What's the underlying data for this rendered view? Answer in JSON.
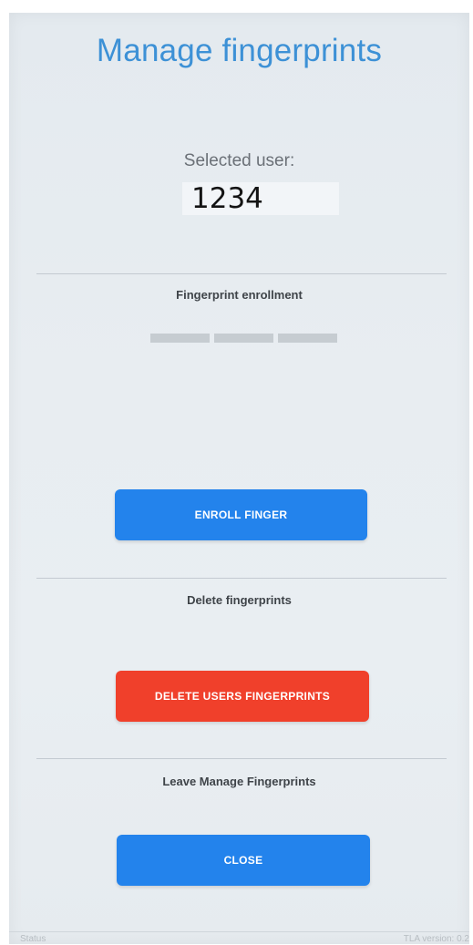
{
  "header": {
    "title": "Manage fingerprints"
  },
  "user": {
    "label": "Selected user:",
    "value": "1234"
  },
  "enrollment": {
    "heading": "Fingerprint enrollment",
    "progress_segments_filled": 0,
    "progress_segments_total": 3,
    "button_label": "ENROLL FINGER"
  },
  "delete": {
    "heading": "Delete fingerprints",
    "button_label": "DELETE USERS FINGERPRINTS"
  },
  "leave": {
    "heading": "Leave Manage Fingerprints",
    "button_label": "CLOSE"
  },
  "status": {
    "left": "Status",
    "right": "TLA version: 0.2"
  },
  "colors": {
    "title": "#3d91d6",
    "primary_button": "#2383ec",
    "danger_button": "#f0402b"
  }
}
